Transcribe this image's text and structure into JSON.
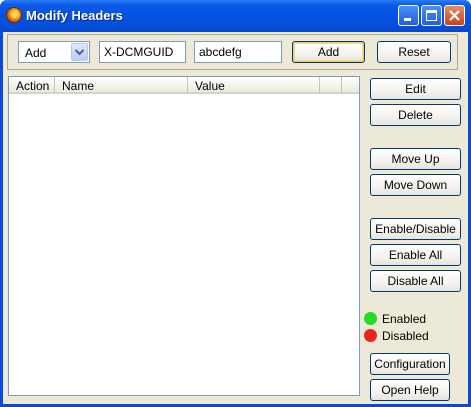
{
  "window": {
    "title": "Modify Headers"
  },
  "toolbar": {
    "action_select": "Add",
    "header_name_value": "X-DCMGUID",
    "header_value_value": "abcdefg",
    "add_label": "Add",
    "reset_label": "Reset"
  },
  "table": {
    "columns": [
      "Action",
      "Name",
      "Value"
    ],
    "rows": []
  },
  "side_buttons": {
    "edit": "Edit",
    "delete": "Delete",
    "move_up": "Move Up",
    "move_down": "Move Down",
    "enable_disable": "Enable/Disable",
    "enable_all": "Enable All",
    "disable_all": "Disable All",
    "configuration": "Configuration",
    "open_help": "Open Help"
  },
  "legend": {
    "enabled": {
      "label": "Enabled",
      "color": "#22dd22"
    },
    "disabled": {
      "label": "Disabled",
      "color": "#ee2222"
    }
  },
  "icons": {
    "app": "firefox-icon",
    "min": "minimize-icon",
    "max": "maximize-icon",
    "close": "close-icon",
    "dropdown": "chevron-down-icon"
  }
}
